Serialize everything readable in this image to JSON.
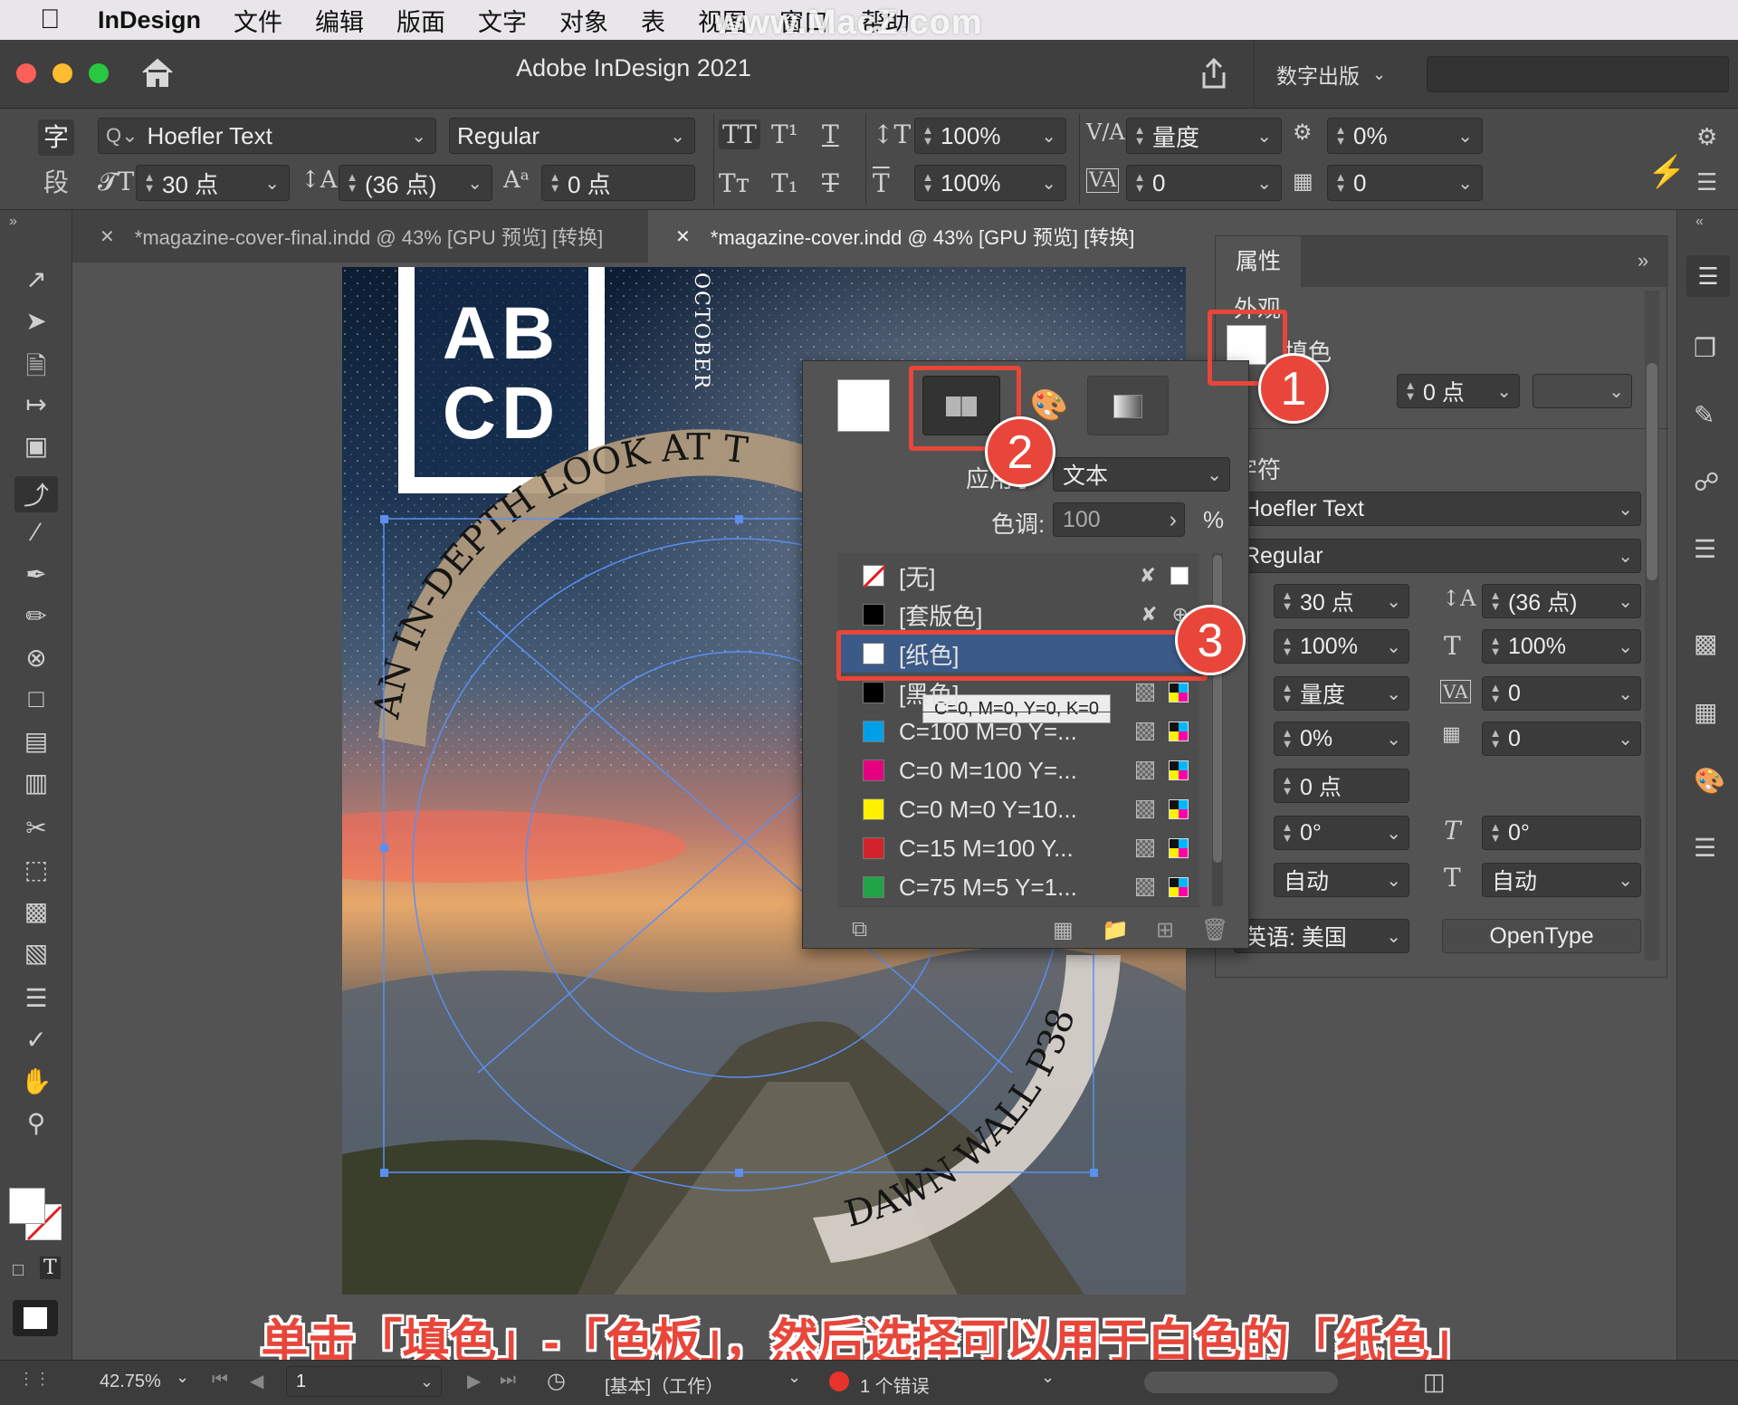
{
  "menubar": {
    "app": "InDesign",
    "items": [
      "文件",
      "编辑",
      "版面",
      "文字",
      "对象",
      "表",
      "视图",
      "窗口",
      "帮助"
    ],
    "watermark": "www.MacZ.com"
  },
  "titlebar": {
    "title": "Adobe InDesign 2021",
    "workspace": "数字出版"
  },
  "control": {
    "char_tab": "字",
    "para_tab": "段",
    "font": "Hoefler Text",
    "style": "Regular",
    "size": "30 点",
    "leading": "(36 点)",
    "baseline_shift": "0 点",
    "vscale": "100%",
    "hscale": "100%",
    "kerning": "量度",
    "tracking": "0",
    "tsume": "0%",
    "grid": "0"
  },
  "tabs": [
    {
      "label": "*magazine-cover-final.indd @ 43% [GPU 预览] [转换]",
      "active": false
    },
    {
      "label": "*magazine-cover.indd @ 43% [GPU 预览] [转换]",
      "active": true
    }
  ],
  "page": {
    "abcd_line1": "AB",
    "abcd_line2": "CD",
    "vertical": "OCTOBER",
    "arc_top": "AN IN-DEPTH LOOK AT T",
    "arc_bottom": "DAWN WALL P38"
  },
  "props": {
    "tab": "属性",
    "appearance": "外观",
    "fill_label": "填色",
    "stroke_weight": "0 点",
    "character": "字符",
    "font": "Hoefler Text",
    "style": "Regular",
    "size": "30 点",
    "leading": "(36 点)",
    "vscale": "100%",
    "hscale": "100%",
    "kerning": "量度",
    "tracking": "0",
    "tsume": "0%",
    "grid": "0",
    "baseline": "0 点",
    "rotate": "0°",
    "skew": "0°",
    "auto1": "自动",
    "auto2": "自动",
    "language": "英语: 美国",
    "opentype": "OpenType"
  },
  "swatches": {
    "apply_label": "应用于",
    "apply_value": "文本",
    "tint_label": "色调:",
    "tint_value": "100",
    "tint_unit": "%",
    "tooltip": "C=0, M=0, Y=0, K=0",
    "rows": [
      {
        "name": "[无]",
        "color": "none"
      },
      {
        "name": "[套版色]",
        "color": "#000000"
      },
      {
        "name": "[纸色]",
        "color": "#ffffff"
      },
      {
        "name": "[黑色]",
        "color": "#000000"
      },
      {
        "name": "C=100 M=0 Y=...",
        "color": "#00a0e9"
      },
      {
        "name": "C=0 M=100 Y=...",
        "color": "#e4007f"
      },
      {
        "name": "C=0 M=0 Y=10...",
        "color": "#fff100"
      },
      {
        "name": "C=15 M=100 Y...",
        "color": "#d2232a"
      },
      {
        "name": "C=75 M=5 Y=1...",
        "color": "#1fa448"
      }
    ]
  },
  "badges": [
    "1",
    "2",
    "3"
  ],
  "caption": "单击「填色」-「色板」，然后选择可以用于白色的「纸色」",
  "status": {
    "zoom": "42.75%",
    "page": "1",
    "preflight": "[基本]（工作）",
    "errors": "1 个错误"
  }
}
